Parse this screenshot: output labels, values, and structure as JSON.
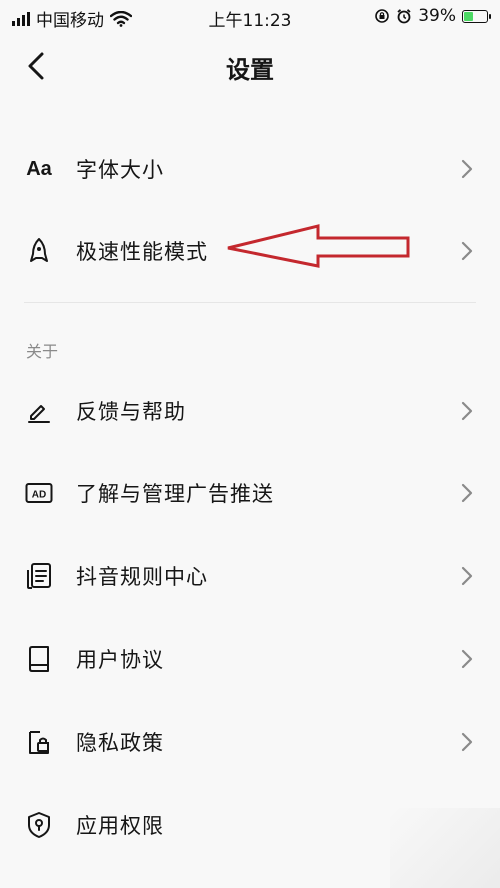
{
  "status_bar": {
    "carrier": "中国移动",
    "time": "上午11:23",
    "battery": "39%",
    "battery_level": 0.39
  },
  "nav": {
    "title": "设置"
  },
  "items": [
    {
      "label": "字体大小",
      "icon": "font-size-icon"
    },
    {
      "label": "极速性能模式",
      "icon": "rocket-icon"
    }
  ],
  "about_section": {
    "header": "关于",
    "items": [
      {
        "label": "反馈与帮助",
        "icon": "pen-icon"
      },
      {
        "label": "了解与管理广告推送",
        "icon": "ad-icon"
      },
      {
        "label": "抖音规则中心",
        "icon": "document-icon"
      },
      {
        "label": "用户协议",
        "icon": "book-icon"
      },
      {
        "label": "隐私政策",
        "icon": "lock-icon"
      },
      {
        "label": "应用权限",
        "icon": "shield-icon"
      }
    ]
  },
  "colors": {
    "background": "#f8f8f8",
    "text": "#161616",
    "secondary_text": "#8a8a8a",
    "annotation_arrow": "#c4282e"
  }
}
